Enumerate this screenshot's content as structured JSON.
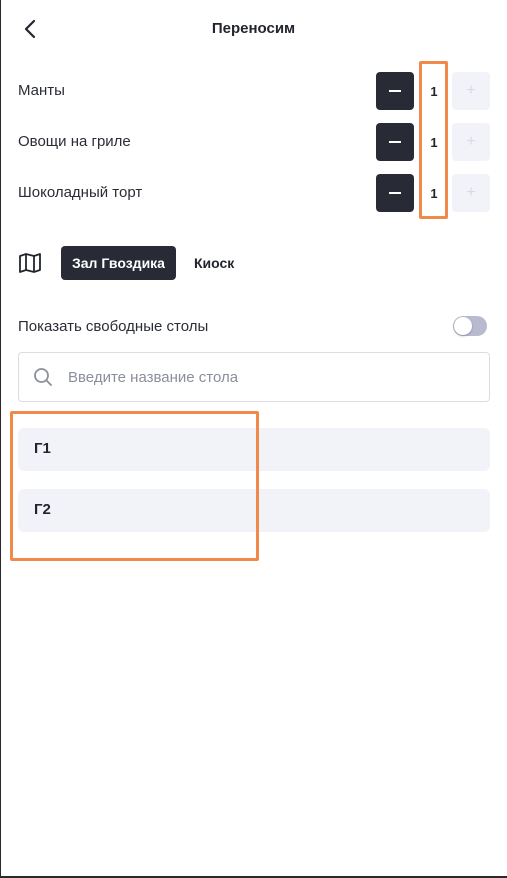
{
  "header": {
    "title": "Переносим",
    "back_icon": "chevron-left-icon"
  },
  "items": [
    {
      "name": "Манты",
      "quantity": "1",
      "minus_label": "−",
      "plus_label": "+"
    },
    {
      "name": "Овощи на гриле",
      "quantity": "1",
      "minus_label": "−",
      "plus_label": "+"
    },
    {
      "name": "Шоколадный торт",
      "quantity": "1",
      "minus_label": "−",
      "plus_label": "+"
    }
  ],
  "halls": {
    "map_icon": "map-icon",
    "active": "Зал Гвоздика",
    "other": "Киоск"
  },
  "free_tables": {
    "label": "Показать свободные столы",
    "enabled": false
  },
  "search": {
    "placeholder": "Введите название стола",
    "value": "",
    "icon": "search-icon"
  },
  "tables": [
    {
      "name": "Г1"
    },
    {
      "name": "Г2"
    }
  ],
  "colors": {
    "dark": "#282b36",
    "highlight": "#f08a4b",
    "light_bg": "#f2f3f8"
  }
}
